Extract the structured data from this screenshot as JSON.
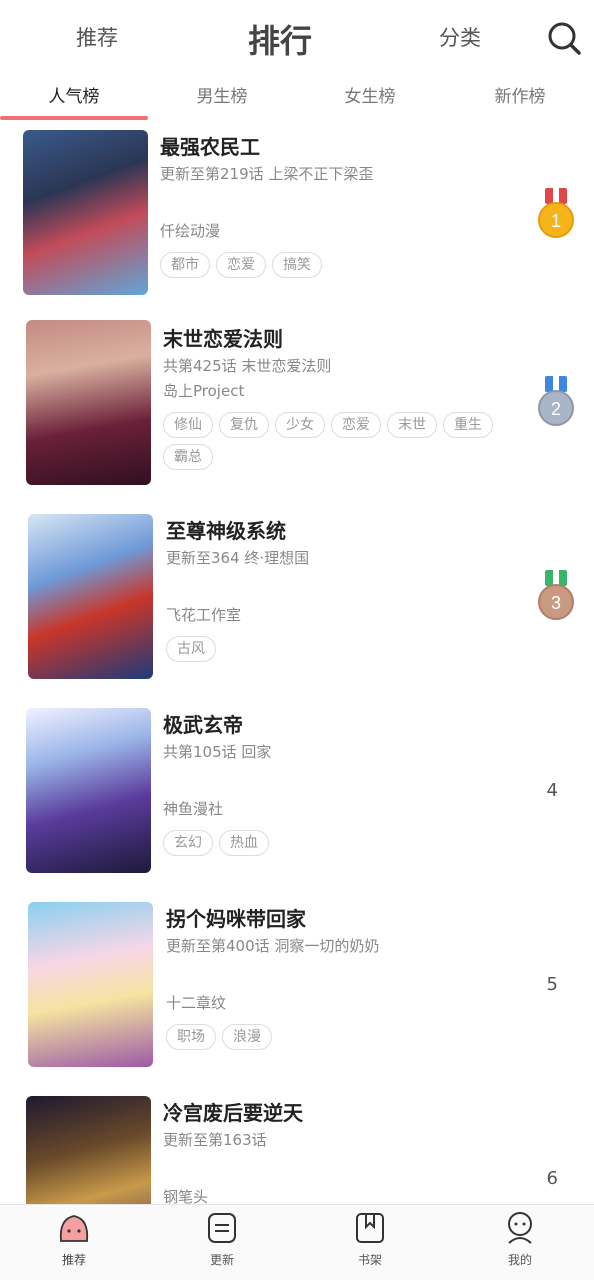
{
  "header": {
    "tabs": [
      "推荐",
      "排行",
      "分类"
    ],
    "active_tab": "排行"
  },
  "subtabs": [
    "人气榜",
    "男生榜",
    "女生榜",
    "新作榜"
  ],
  "comics": [
    {
      "title": "最强农民工",
      "line1": "更新至第219话 上梁不正下梁歪",
      "line2": "",
      "author": "仟绘动漫",
      "tags": [
        "都市",
        "恋爱",
        "搞笑"
      ],
      "rank": "1",
      "rank_style": "gold"
    },
    {
      "title": "末世恋爱法则",
      "line1": "共第425话 末世恋爱法则",
      "line2": "",
      "author": "岛上Project",
      "tags": [
        "修仙",
        "复仇",
        "少女",
        "恋爱",
        "末世",
        "重生",
        "霸总"
      ],
      "rank": "2",
      "rank_style": "silver"
    },
    {
      "title": "至尊神级系统",
      "line1": "更新至364 终·理想国",
      "line2": "",
      "author": "飞花工作室",
      "tags": [
        "古风"
      ],
      "rank": "3",
      "rank_style": "bronze"
    },
    {
      "title": "极武玄帝",
      "line1": "共第105话 回家",
      "line2": "",
      "author": "神鱼漫社",
      "tags": [
        "玄幻",
        "热血"
      ],
      "rank": "4",
      "rank_style": "plain"
    },
    {
      "title": "拐个妈咪带回家",
      "line1": "更新至第400话 洞察一切的奶奶",
      "line2": "",
      "author": "十二章纹",
      "tags": [
        "职场",
        "浪漫"
      ],
      "rank": "5",
      "rank_style": "plain"
    },
    {
      "title": "冷宫废后要逆天",
      "line1": "更新至第163话",
      "line2": "",
      "author": "钢笔头",
      "tags": [],
      "rank": "6",
      "rank_style": "plain"
    }
  ],
  "bottom_nav": [
    {
      "label": "推荐",
      "icon": "home-face-icon"
    },
    {
      "label": "更新",
      "icon": "update-icon"
    },
    {
      "label": "书架",
      "icon": "bookshelf-icon"
    },
    {
      "label": "我的",
      "icon": "profile-icon"
    }
  ],
  "colors": {
    "accent": "#f07070",
    "gold": "#f5b41a",
    "silver": "#a9b4c6",
    "bronze": "#c99a82"
  }
}
